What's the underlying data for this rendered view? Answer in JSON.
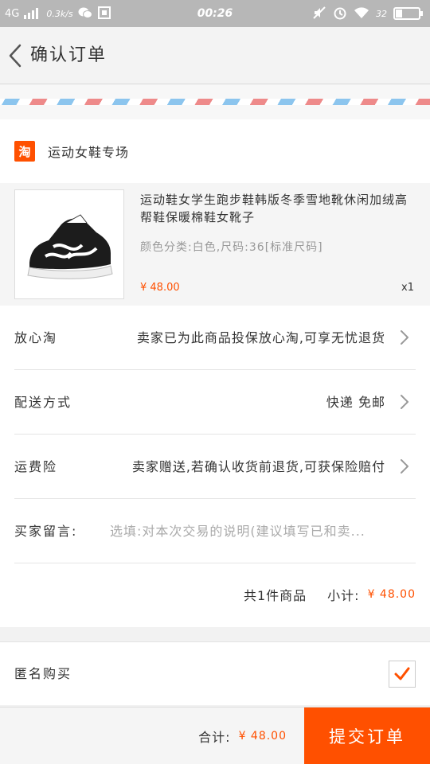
{
  "status_bar": {
    "network": "4G",
    "speed": "0.3k/s",
    "time": "00:26",
    "battery": "32"
  },
  "header": {
    "title": "确认订单"
  },
  "shop": {
    "logo_text": "淘",
    "name": "运动女鞋专场",
    "logo_color": "#ff5000"
  },
  "product": {
    "title": "运动鞋女学生跑步鞋韩版冬季雪地靴休闲加绒高帮鞋保暖棉鞋女靴子",
    "spec": "颜色分类:白色,尺码:36[标准尺码]",
    "price": "¥ 48.00",
    "quantity": "x1"
  },
  "rows": {
    "insurance": {
      "label": "放心淘",
      "value": "卖家已为此商品投保放心淘,可享无忧退货"
    },
    "delivery": {
      "label": "配送方式",
      "value": "快递 免邮"
    },
    "shipping_insurance": {
      "label": "运费险",
      "value": "卖家赠送,若确认收货前退货,可获保险赔付"
    },
    "message": {
      "label": "买家留言:",
      "placeholder": "选填:对本次交易的说明(建议填写已和卖..."
    }
  },
  "summary": {
    "count_text": "共1件商品",
    "subtotal_label": "小计:",
    "subtotal_value": "¥ 48.00"
  },
  "anonymous": {
    "label": "匿名购买",
    "checked": true
  },
  "bottom_bar": {
    "total_label": "合计:",
    "total_value": "¥ 48.00",
    "submit_label": "提交订单",
    "accent_color": "#ff5000"
  }
}
